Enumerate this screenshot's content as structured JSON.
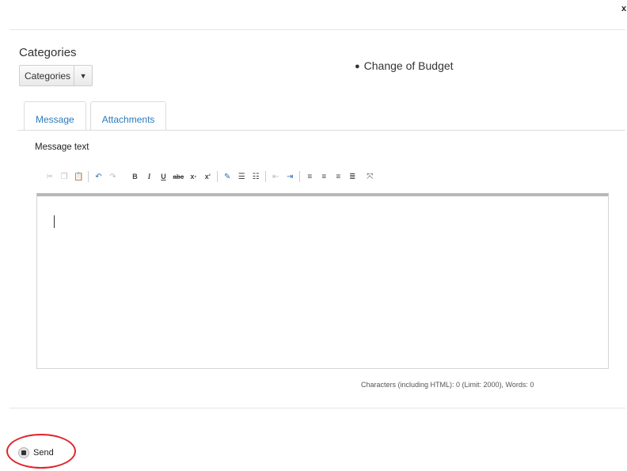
{
  "dialog": {
    "close_glyph": "x"
  },
  "categories": {
    "label": "Categories",
    "select_value": "Categories",
    "selected_items": [
      "Change of Budget"
    ]
  },
  "tabs": [
    {
      "label": "Message",
      "active": true
    },
    {
      "label": "Attachments",
      "active": false
    }
  ],
  "editor": {
    "label": "Message text",
    "toolbar": [
      "cut-icon",
      "copy-icon",
      "paste-from-word-icon",
      "undo-icon",
      "redo-icon",
      "bold-icon",
      "italic-icon",
      "underline-icon",
      "strikethrough-icon",
      "subscript-icon",
      "superscript-icon",
      "remove-format-icon",
      "numbered-list-icon",
      "bulleted-list-icon",
      "outdent-icon",
      "indent-icon",
      "align-left-icon",
      "align-center-icon",
      "align-right-icon",
      "justify-icon",
      "maximize-icon"
    ],
    "text": "",
    "counter": "Characters (including HTML): 0 (Limit: 2000), Words: 0"
  },
  "footer": {
    "send_label": "Send",
    "highlight_color": "#e2242b"
  },
  "colors": {
    "link": "#2b7bbd",
    "undo": "#2b6fb7"
  }
}
